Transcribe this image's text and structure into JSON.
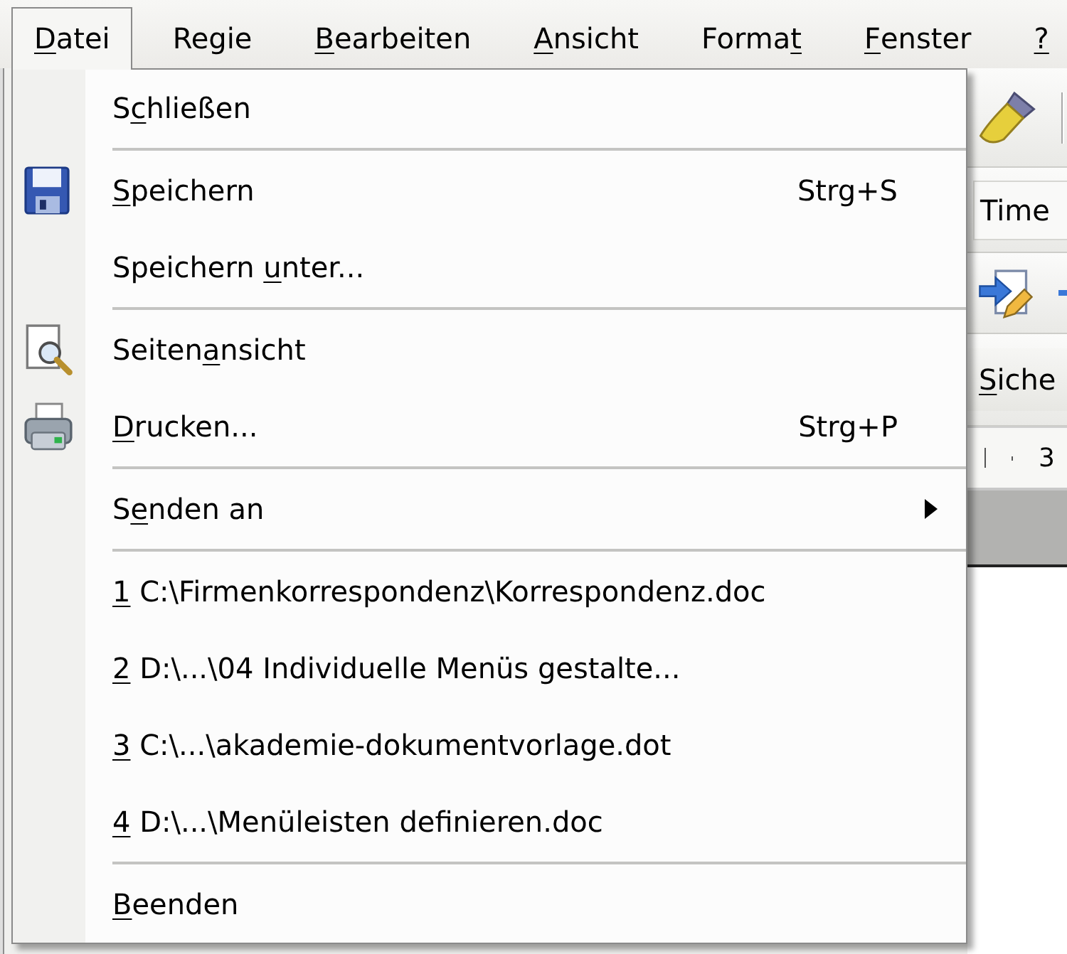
{
  "menu_bar": {
    "items": [
      {
        "label": {
          "key": "D",
          "after": "atei"
        },
        "selected": true
      },
      {
        "label": {
          "before": "Regie"
        },
        "selected": false
      },
      {
        "label": {
          "key": "B",
          "after": "earbeiten"
        },
        "selected": false
      },
      {
        "label": {
          "key": "A",
          "after": "nsicht"
        },
        "selected": false
      },
      {
        "label": {
          "before": "Forma",
          "key": "t"
        },
        "selected": false
      },
      {
        "label": {
          "key": "F",
          "after": "enster"
        },
        "selected": false
      },
      {
        "label": {
          "key": "?"
        },
        "selected": false
      }
    ]
  },
  "file_menu": {
    "groups": [
      {
        "items": [
          {
            "kind": "plain",
            "label": {
              "before": "S",
              "key": "c",
              "after": "hließen"
            }
          }
        ]
      },
      {
        "items": [
          {
            "kind": "save",
            "label": {
              "key": "S",
              "after": "peichern"
            },
            "shortcut": "Strg+S"
          },
          {
            "kind": "plain",
            "label": {
              "before": "Speichern ",
              "key": "u",
              "after": "nter..."
            }
          }
        ]
      },
      {
        "items": [
          {
            "kind": "preview",
            "label": {
              "before": "Seiten",
              "key": "a",
              "after": "nsicht"
            }
          },
          {
            "kind": "print",
            "label": {
              "key": "D",
              "after": "rucken..."
            },
            "shortcut": "Strg+P"
          }
        ]
      },
      {
        "items": [
          {
            "kind": "submenu",
            "label": {
              "before": "S",
              "key": "e",
              "after": "nden an"
            }
          }
        ]
      },
      {
        "items": [
          {
            "kind": "plain",
            "label": {
              "key": "1",
              "after": " C:\\Firmenkorrespondenz\\Korrespondenz.doc"
            }
          },
          {
            "kind": "plain",
            "label": {
              "key": "2",
              "after": " D:\\...\\04 Individuelle Menüs gestalte..."
            }
          },
          {
            "kind": "plain",
            "label": {
              "key": "3",
              "after": " C:\\...\\akademie-dokumentvorlage.dot"
            }
          },
          {
            "kind": "plain",
            "label": {
              "key": "4",
              "after": " D:\\...\\Menüleisten definieren.doc"
            }
          }
        ]
      },
      {
        "items": [
          {
            "kind": "plain",
            "label": {
              "key": "B",
              "after": "eenden"
            }
          }
        ]
      }
    ]
  },
  "toolbars": {
    "font_name": "Time",
    "button": {
      "label": {
        "key": "S",
        "after": "iche"
      }
    }
  },
  "ruler": {
    "label": "3"
  }
}
